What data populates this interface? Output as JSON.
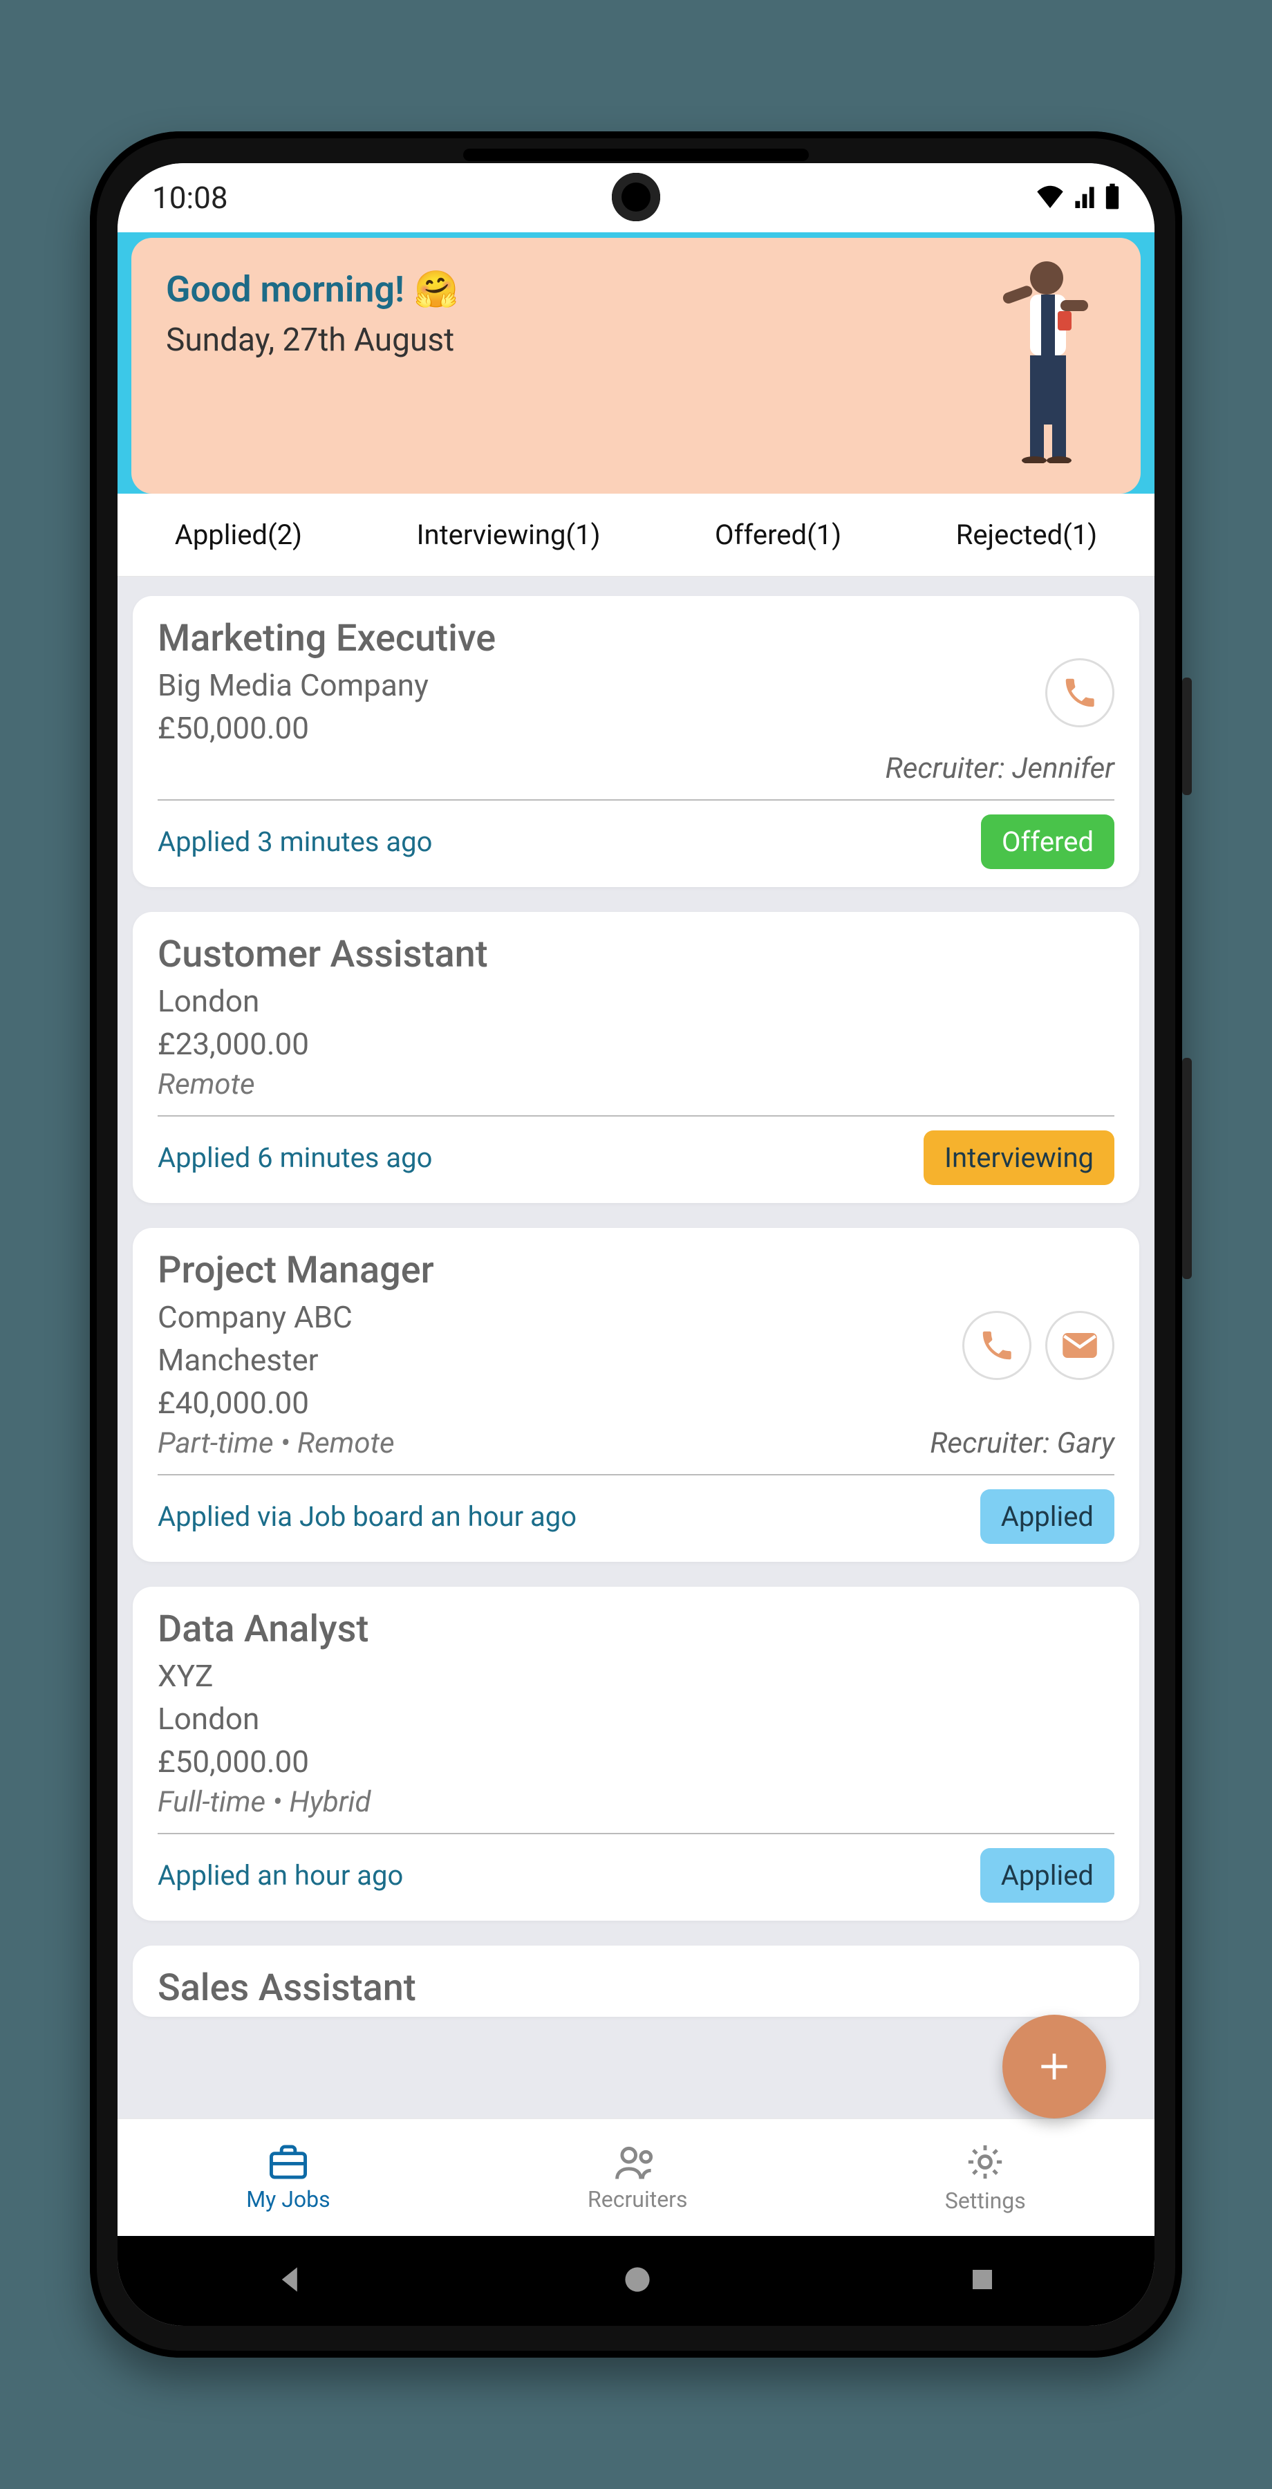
{
  "status": {
    "time": "10:08"
  },
  "greeting": {
    "title": "Good morning!",
    "emoji": "🤗",
    "date": "Sunday, 27th August"
  },
  "tabs": [
    {
      "label": "Applied(2)"
    },
    {
      "label": "Interviewing(1)"
    },
    {
      "label": "Offered(1)"
    },
    {
      "label": "Rejected(1)"
    }
  ],
  "jobs": [
    {
      "title": "Marketing Executive",
      "company": "Big Media Company",
      "salary": "£50,000.00",
      "recruiter": "Recruiter: Jennifer",
      "applied": "Applied 3 minutes ago",
      "status": "Offered"
    },
    {
      "title": "Customer Assistant",
      "location": "London",
      "salary": "£23,000.00",
      "work_mode": "Remote",
      "applied": "Applied 6 minutes ago",
      "status": "Interviewing"
    },
    {
      "title": "Project Manager",
      "company": "Company ABC",
      "location": "Manchester",
      "salary": "£40,000.00",
      "work_mode": "Part-time • Remote",
      "recruiter": "Recruiter: Gary",
      "applied": "Applied via Job board an hour ago",
      "status": "Applied"
    },
    {
      "title": "Data Analyst",
      "company": "XYZ",
      "location": "London",
      "salary": "£50,000.00",
      "work_mode": "Full-time • Hybrid",
      "applied": "Applied an hour ago",
      "status": "Applied"
    },
    {
      "title": "Sales Assistant"
    }
  ],
  "nav": {
    "my_jobs": "My Jobs",
    "recruiters": "Recruiters",
    "settings": "Settings"
  },
  "colors": {
    "accent_teal": "#3cc8e8",
    "peach": "#fbd1b9",
    "fab": "#d78c62",
    "offered": "#49c34a",
    "interviewing": "#f6b22d",
    "applied_pill": "#7ecff3",
    "link_blue": "#1b6d8a"
  }
}
